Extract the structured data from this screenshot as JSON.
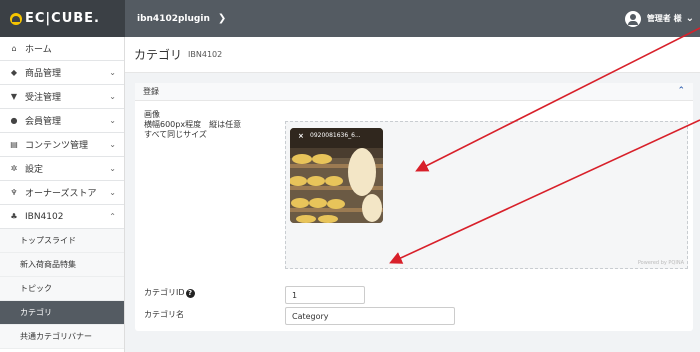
{
  "header": {
    "logo": "EC|CUBE.",
    "shop": "ibn4102plugin",
    "user": "管理者 様"
  },
  "sidebar": {
    "items": [
      {
        "label": "ホーム",
        "icon": "home-icon"
      },
      {
        "label": "商品管理",
        "icon": "box-icon"
      },
      {
        "label": "受注管理",
        "icon": "cart-icon"
      },
      {
        "label": "会員管理",
        "icon": "users-icon"
      },
      {
        "label": "コンテンツ管理",
        "icon": "document-icon"
      },
      {
        "label": "設定",
        "icon": "gear-icon"
      },
      {
        "label": "オーナーズストア",
        "icon": "plug-icon"
      },
      {
        "label": "IBN4102",
        "icon": "puzzle-icon"
      }
    ],
    "subitems": [
      "トップスライド",
      "新入荷商品特集",
      "トピック",
      "カテゴリ",
      "共通カテゴリバナー"
    ]
  },
  "page": {
    "title": "カテゴリ",
    "subtitle": "IBN4102"
  },
  "card": {
    "title": "登録",
    "image_label": "画像",
    "image_note1": "横幅600px程度　縦は任意",
    "image_note2": "すべて同じサイズ",
    "thumb_name": "0920081636_6...",
    "powered": "Powered by PQINA",
    "id_label": "カテゴリID",
    "id_value": "1",
    "name_label": "カテゴリ名",
    "name_value": "Category"
  },
  "colors": {
    "header": "#545b62",
    "logo_bg": "#3b4045",
    "active": "#545b62",
    "arrow": "#d8202a"
  }
}
